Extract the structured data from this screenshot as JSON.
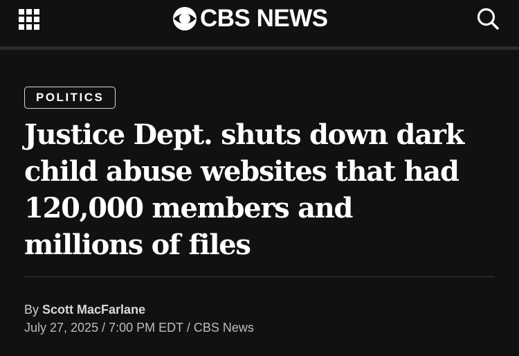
{
  "header": {
    "logo_text": "CBS NEWS",
    "menu_icon": "grid-menu-icon",
    "search_icon": "search-icon"
  },
  "article": {
    "category": "POLITICS",
    "headline": "Justice Dept. shuts down dark child abuse websites that had 120,000 members and millions of files",
    "byline_prefix": "By",
    "author": "Scott MacFarlane",
    "date": "July 27, 2025",
    "separator": "/",
    "time": "7:00 PM EDT",
    "source": "CBS News"
  },
  "colors": {
    "background": "#111111",
    "text": "#ffffff",
    "muted_text": "#bdbdbd"
  }
}
